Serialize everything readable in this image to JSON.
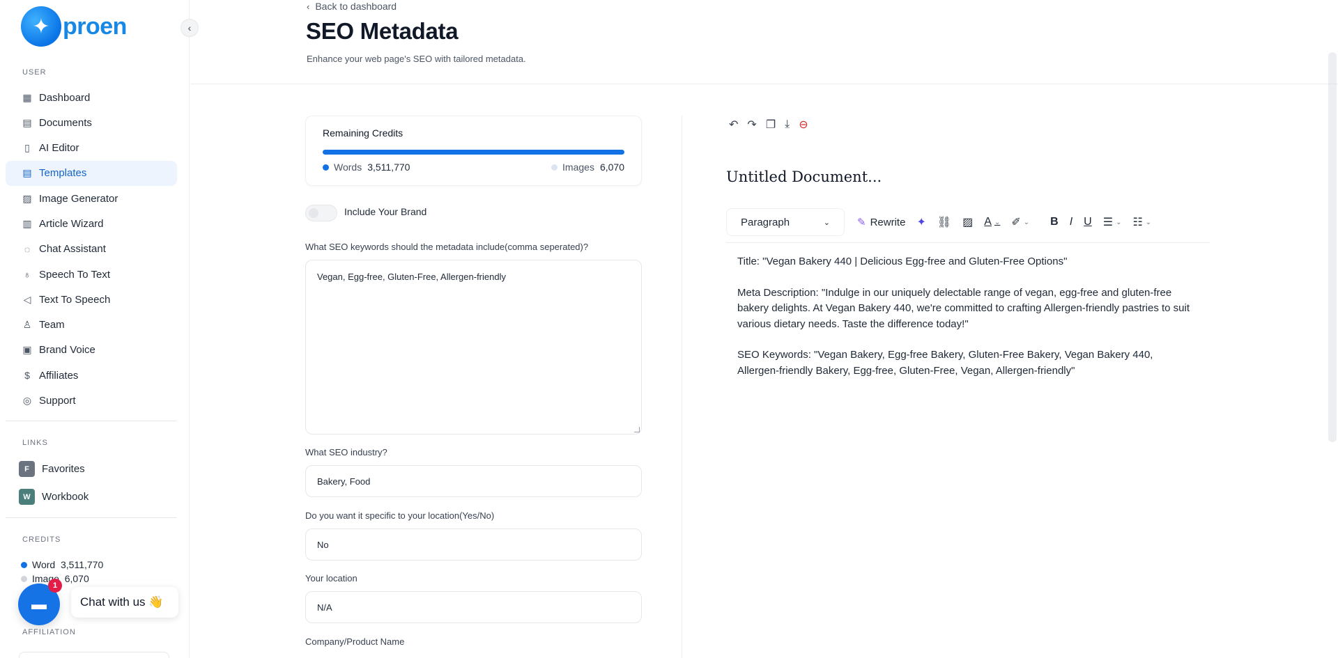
{
  "brand": {
    "name": "proen"
  },
  "sidebar": {
    "user_label": "USER",
    "items": [
      {
        "label": "Dashboard",
        "icon": "grid-icon"
      },
      {
        "label": "Documents",
        "icon": "archive-icon"
      },
      {
        "label": "AI Editor",
        "icon": "book-icon"
      },
      {
        "label": "Templates",
        "icon": "file-text-icon"
      },
      {
        "label": "Image Generator",
        "icon": "image-icon"
      },
      {
        "label": "Article Wizard",
        "icon": "file-edit-icon"
      },
      {
        "label": "Chat Assistant",
        "icon": "message-icon"
      },
      {
        "label": "Speech To Text",
        "icon": "mic-icon"
      },
      {
        "label": "Text To Speech",
        "icon": "volume-icon"
      },
      {
        "label": "Team",
        "icon": "user-plus-icon"
      },
      {
        "label": "Brand Voice",
        "icon": "layout-icon"
      },
      {
        "label": "Affiliates",
        "icon": "dollar-icon"
      },
      {
        "label": "Support",
        "icon": "lifebuoy-icon"
      }
    ],
    "links_label": "LINKS",
    "links": [
      {
        "badge": "F",
        "label": "Favorites",
        "color": "#6b7280"
      },
      {
        "badge": "W",
        "label": "Workbook",
        "color": "#4b7f7b"
      }
    ],
    "credits_label": "CREDITS",
    "credits": {
      "word_label": "Word",
      "word_value": "3,511,770",
      "image_label": "Image",
      "image_value": "6,070"
    },
    "affiliation_label": "AFFILIATION"
  },
  "chat": {
    "label": "Chat with us 👋",
    "badge": "1"
  },
  "header": {
    "back": "Back to dashboard",
    "title": "SEO Metadata",
    "subtitle": "Enhance your web page's SEO with tailored metadata."
  },
  "credits_card": {
    "title": "Remaining Credits",
    "words_label": "Words",
    "words_value": "3,511,770",
    "images_label": "Images",
    "images_value": "6,070"
  },
  "brand_toggle": {
    "label": "Include Your Brand",
    "on": false
  },
  "form": {
    "q1": "What SEO keywords should the metadata include(comma seperated)?",
    "a1": "Vegan, Egg-free, Gluten-Free, Allergen-friendly",
    "q2": "What SEO industry?",
    "a2": "Bakery, Food",
    "q3": "Do you want it specific to your location(Yes/No)",
    "a3": "No",
    "q4": "Your location",
    "a4": "N/A",
    "q5": "Company/Product Name"
  },
  "editor": {
    "doc_title": "Untitled Document...",
    "paragraph_select": "Paragraph",
    "rewrite": "Rewrite",
    "body": [
      "Title: \"Vegan Bakery 440 | Delicious Egg-free and Gluten-Free Options\"",
      "Meta Description: \"Indulge in our uniquely delectable range of vegan, egg-free and gluten-free bakery delights. At Vegan Bakery 440, we're committed to crafting Allergen-friendly pastries to suit various dietary needs. Taste the difference today!\"",
      "SEO Keywords: \"Vegan Bakery, Egg-free Bakery, Gluten-Free Bakery, Vegan Bakery 440, Allergen-friendly Bakery, Egg-free, Gluten-Free, Vegan, Allergen-friendly\""
    ]
  }
}
